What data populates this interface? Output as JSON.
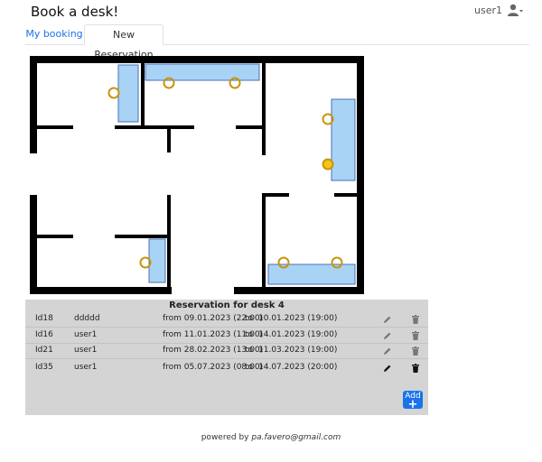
{
  "header": {
    "app_title": "Book a desk!",
    "username": "user1",
    "user_icon": "user-dropdown-icon"
  },
  "tabs": [
    {
      "label": "My booking",
      "active": false
    },
    {
      "label": "New Reservation",
      "active": true
    }
  ],
  "colors": {
    "desk_fill": "#a9d3f5",
    "chair_stroke": "#c8960c",
    "link_blue": "#1a73e8",
    "panel_bg": "#d4d4d4"
  },
  "reservations": {
    "title": "Reservation for desk 4",
    "rows": [
      {
        "id": "Id18",
        "user": "ddddd",
        "from": "from 09.01.2023  (22:00)",
        "to_label": "to",
        "to": "10.01.2023  (19:00)"
      },
      {
        "id": "Id16",
        "user": "user1",
        "from": "from 11.01.2023  (11:00)",
        "to_label": "to",
        "to": "14.01.2023  (19:00)"
      },
      {
        "id": "Id21",
        "user": "user1",
        "from": "from 28.02.2023  (13:00)",
        "to_label": "to",
        "to": "11.03.2023  (19:00)"
      },
      {
        "id": "Id35",
        "user": "user1",
        "from": "from 05.07.2023  (08:00)",
        "to_label": "to",
        "to": "14.07.2023  (20:00)"
      }
    ],
    "add_label": "Add"
  },
  "footer": {
    "prefix": "powered by ",
    "email": "pa.favero@gmail.com"
  }
}
